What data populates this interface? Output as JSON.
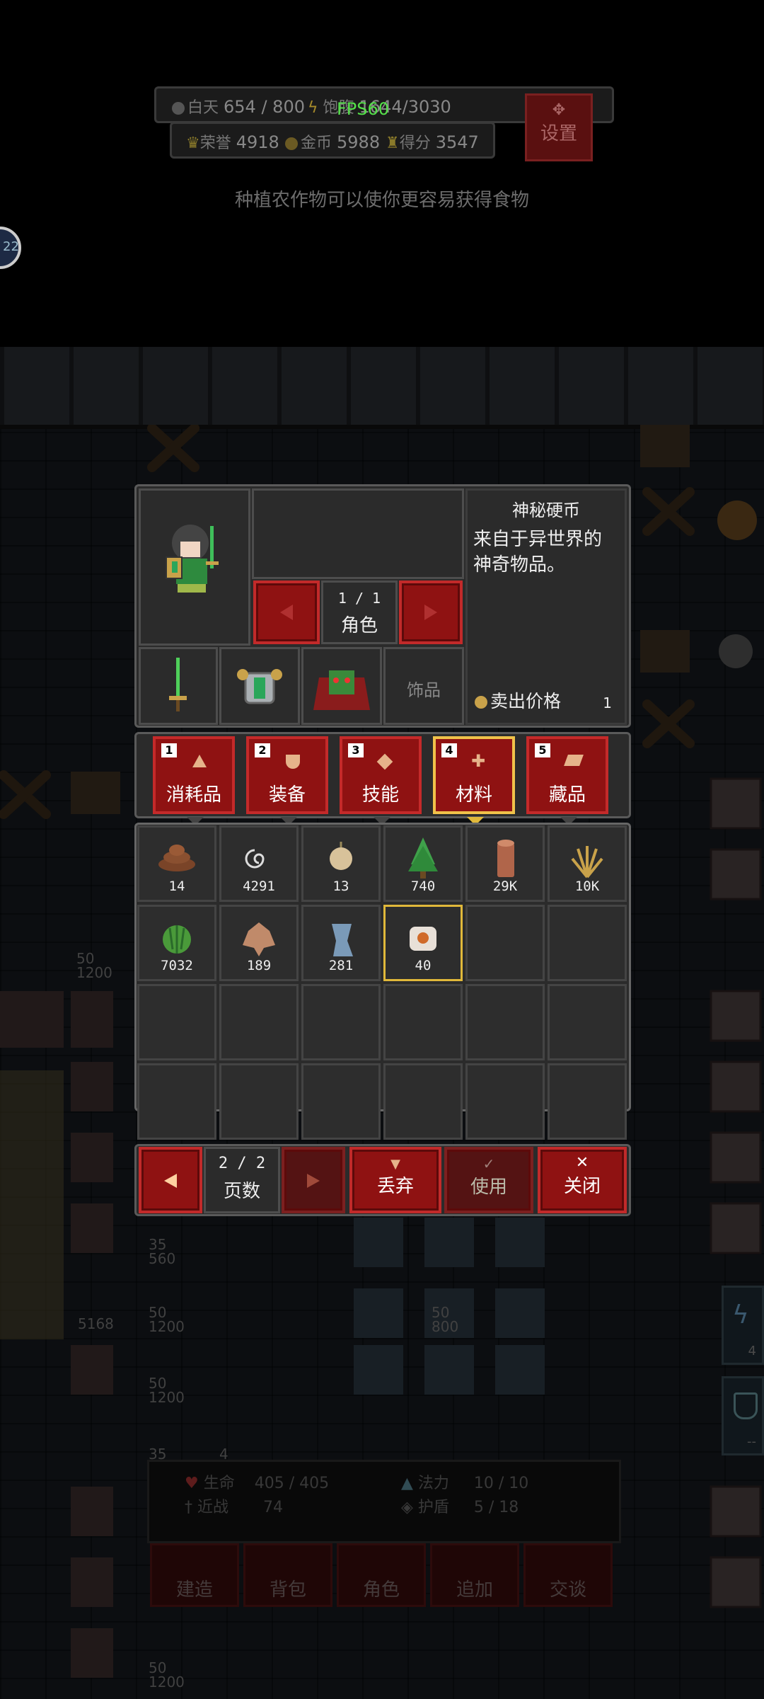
{
  "hud": {
    "day_label": "白天",
    "day_value": "654 / 800",
    "food_label": "饱腹",
    "food_value": "1644/3030",
    "honor_label": "荣誉",
    "honor_value": "4918",
    "gold_label": "金币",
    "gold_value": "5988",
    "score_label": "得分",
    "score_value": "3547",
    "fps": "FPS60",
    "settings_label": "设置",
    "hint": "种植农作物可以使你更容易获得食物",
    "left_badge": "22"
  },
  "character": {
    "page": "1 / 1",
    "page_label": "角色",
    "equip_slots": [
      "sword-icon",
      "armor-icon",
      "cape-icon",
      "饰品"
    ]
  },
  "item_detail": {
    "name": "神秘硬币",
    "description": "来自于异世界的神奇物品。",
    "sell_label": "卖出价格",
    "sell_value": "1"
  },
  "tabs": [
    {
      "num": "1",
      "label": "消耗品",
      "icon": "flask-icon"
    },
    {
      "num": "2",
      "label": "装备",
      "icon": "shield-icon"
    },
    {
      "num": "3",
      "label": "技能",
      "icon": "diamond-icon"
    },
    {
      "num": "4",
      "label": "材料",
      "icon": "plus-icon",
      "selected": true
    },
    {
      "num": "5",
      "label": "藏品",
      "icon": "scroll-icon"
    }
  ],
  "inventory": [
    {
      "icon": "dung-icon",
      "qty": "14"
    },
    {
      "icon": "spiral-icon",
      "qty": "4291"
    },
    {
      "icon": "onion-icon",
      "qty": "13"
    },
    {
      "icon": "tree-icon",
      "qty": "740"
    },
    {
      "icon": "log-icon",
      "qty": "29K"
    },
    {
      "icon": "wheat-icon",
      "qty": "10K"
    },
    {
      "icon": "melon-icon",
      "qty": "7032"
    },
    {
      "icon": "leather-icon",
      "qty": "189"
    },
    {
      "icon": "paper-icon",
      "qty": "281"
    },
    {
      "icon": "coin-icon",
      "qty": "40",
      "selected": true
    }
  ],
  "footer": {
    "page": "2 / 2",
    "page_label": "页数",
    "discard": "丢弃",
    "use": "使用",
    "close": "关闭"
  },
  "stats": {
    "hp_label": "生命",
    "hp_value": "405 / 405",
    "mp_label": "法力",
    "mp_value": "10 / 10",
    "melee_label": "近战",
    "melee_value": "74",
    "shield_label": "护盾",
    "shield_value": "5 / 18"
  },
  "bottom_menu": [
    "建造",
    "背包",
    "角色",
    "追加",
    "交谈"
  ],
  "units": [
    {
      "a": "50",
      "b": "1200"
    },
    {
      "a": "35",
      "b": "560"
    },
    {
      "a": "5168",
      "b": ""
    },
    {
      "a": "50",
      "b": "1200"
    },
    {
      "a": "50",
      "b": "800"
    },
    {
      "a": "50",
      "b": "1200"
    },
    {
      "a": "35",
      "b": ""
    },
    {
      "a": "4",
      "b": ""
    },
    {
      "a": "50",
      "b": "1200"
    }
  ],
  "right_icons": [
    {
      "icon": "lightning-icon",
      "count": "4"
    },
    {
      "icon": "shield-icon",
      "count": "--"
    }
  ]
}
